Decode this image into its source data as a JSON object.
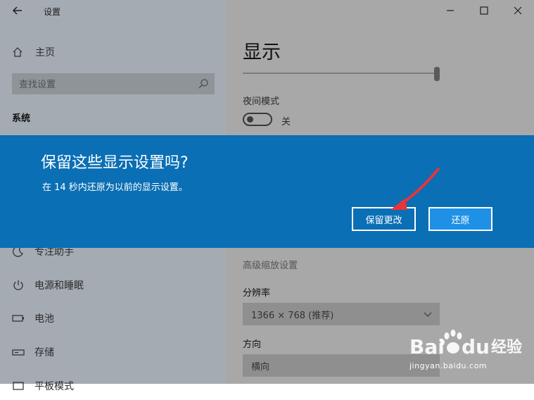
{
  "window": {
    "title": "设置"
  },
  "sidebar": {
    "home_label": "主页",
    "search_placeholder": "查找设置",
    "section_title": "系统",
    "items": [
      {
        "label": "专注助手",
        "icon": "moon-icon"
      },
      {
        "label": "电源和睡眠",
        "icon": "power-icon"
      },
      {
        "label": "电池",
        "icon": "battery-icon"
      },
      {
        "label": "存储",
        "icon": "storage-icon"
      },
      {
        "label": "平板模式",
        "icon": "tablet-icon"
      }
    ]
  },
  "main": {
    "heading": "显示",
    "night_mode_label": "夜间模式",
    "night_mode_state": "关",
    "advanced_scaling_link": "高级缩放设置",
    "resolution_label": "分辨率",
    "resolution_value": "1366 × 768 (推荐)",
    "orientation_label": "方向",
    "orientation_value": "横向"
  },
  "dialog": {
    "title": "保留这些显示设置吗?",
    "message": "在 14 秒内还原为以前的显示设置。",
    "keep_label": "保留更改",
    "revert_label": "还原"
  },
  "watermark": {
    "brand_text": "Baidu经验",
    "url": "jingyan.baidu.com"
  },
  "colors": {
    "dialog_bg": "#0a6fb4",
    "revert_bg": "#1e90e6",
    "annotation_arrow": "#e8343a"
  }
}
